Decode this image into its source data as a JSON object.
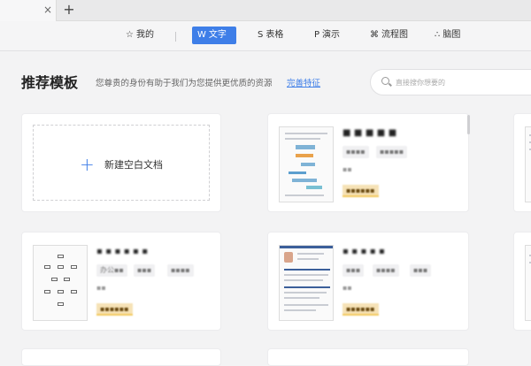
{
  "tabs": {
    "close_glyph": "×",
    "new_tab_glyph": "+"
  },
  "categories": [
    {
      "label": "我的",
      "icon": "star-icon",
      "glyph": "☆"
    },
    {
      "label": "文字",
      "icon": "word-icon",
      "glyph": "W",
      "active": true
    },
    {
      "label": "表格",
      "icon": "sheet-icon",
      "glyph": "S"
    },
    {
      "label": "演示",
      "icon": "presentation-icon",
      "glyph": "P"
    },
    {
      "label": "流程图",
      "icon": "flowchart-icon",
      "glyph": "⌘"
    },
    {
      "label": "脑图",
      "icon": "mindmap-icon",
      "glyph": "∴"
    }
  ],
  "section": {
    "title": "推荐模板",
    "subtitle": "您尊贵的身份有助于我们为您提供更优质的资源",
    "link": "完善特征"
  },
  "search": {
    "placeholder": "直接搜你想要的"
  },
  "new_doc": {
    "label": "新建空白文档",
    "plus_glyph": "+"
  },
  "templates": [
    {
      "title": "■ ■ ■ ■ ■",
      "tags": [
        "▪▪▪▪",
        "▪▪▪▪▪"
      ],
      "meta": "▪▪",
      "price": "▪▪▪▪▪▪"
    },
    {
      "title": "▪ ▪ ▪ ▪ ▪ ▪",
      "tags": [
        "办公▪▪",
        "▪▪▪",
        "▪▪▪▪"
      ],
      "meta": "▪▪",
      "price": "▪▪▪▪▪▪"
    },
    {
      "title": "▪ ▪ ▪ ▪ ▪",
      "tags": [
        "▪▪▪",
        "▪▪▪▪",
        "▪▪▪"
      ],
      "meta": "▪▪",
      "price": "▪▪▪▪▪▪"
    }
  ],
  "accent_color": "#3e7ee8",
  "price_tag_color": "#f6e2b6"
}
